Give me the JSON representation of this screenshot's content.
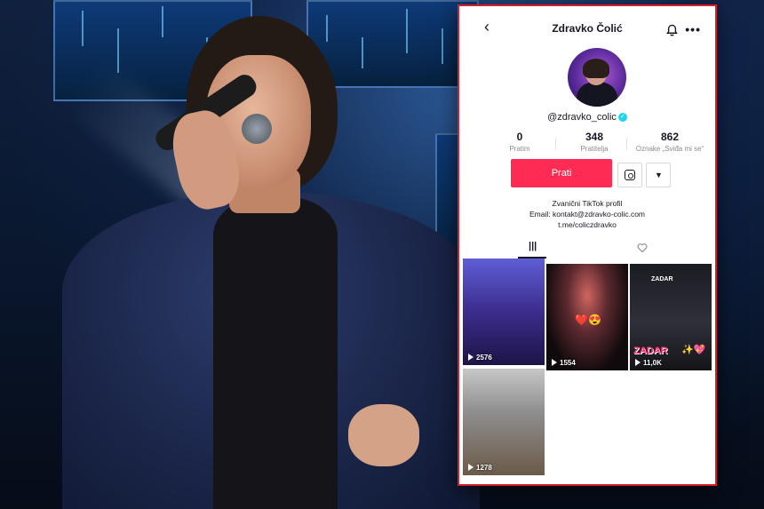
{
  "profile": {
    "name": "Zdravko Čolić",
    "handle": "@zdravko_colic",
    "stats": [
      {
        "value": "0",
        "label": "Pratim"
      },
      {
        "value": "348",
        "label": "Pratitelja"
      },
      {
        "value": "862",
        "label": "Oznake „Sviđa mi se“"
      }
    ],
    "follow_label": "Prati",
    "bio": [
      "Zvanični TikTok profil",
      "Email: kontakt@zdravko-colic.com",
      "t.me/coliczdravko"
    ]
  },
  "videos": [
    {
      "views": "2576"
    },
    {
      "views": "1554"
    },
    {
      "views": "11,0K",
      "overlay": "ZADAR",
      "top_text": "ZADAR"
    },
    {
      "views": "1278"
    }
  ],
  "icons": [
    "back-arrow-icon",
    "bell-icon",
    "more-dots-icon",
    "verified-badge-icon",
    "instagram-icon",
    "chevron-down-icon",
    "grid-icon",
    "liked-heart-icon",
    "play-icon"
  ],
  "colors": {
    "follow_button": "#fe2c55",
    "frame_border": "#d71e2b",
    "verified": "#20d5ec"
  }
}
